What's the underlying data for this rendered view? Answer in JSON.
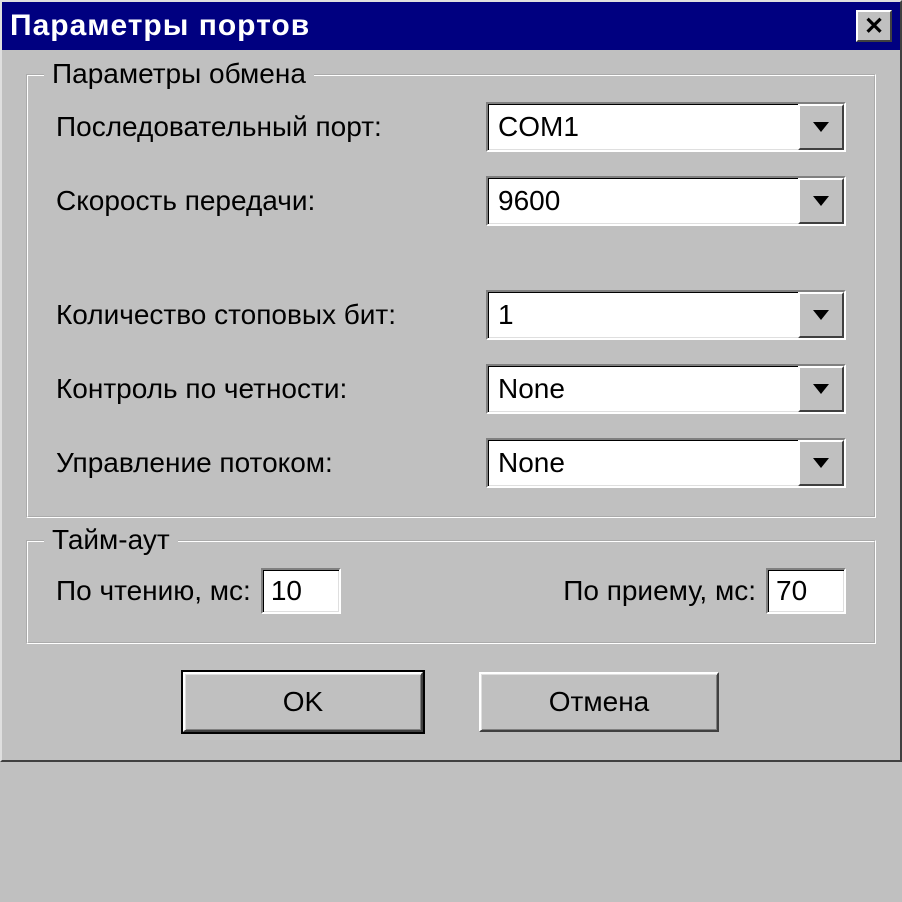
{
  "window": {
    "title": "Параметры портов"
  },
  "exchange": {
    "legend": "Параметры обмена",
    "port_label": "Последовательный порт:",
    "port_value": "COM1",
    "baud_label": "Скорость передачи:",
    "baud_value": "9600",
    "stopbits_label": "Количество стоповых бит:",
    "stopbits_value": "1",
    "parity_label": "Контроль по четности:",
    "parity_value": "None",
    "flow_label": "Управление потоком:",
    "flow_value": "None"
  },
  "timeout": {
    "legend": "Тайм-аут",
    "read_label": "По чтению, мс:",
    "read_value": "10",
    "receive_label": "По приему, мс:",
    "receive_value": "70"
  },
  "buttons": {
    "ok": "OK",
    "cancel": "Отмена"
  }
}
